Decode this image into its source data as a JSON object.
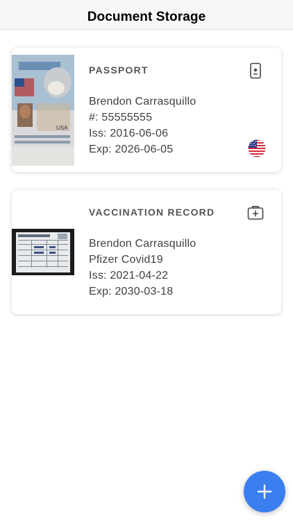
{
  "header": {
    "title": "Document Storage"
  },
  "documents": [
    {
      "type_label": "PASSPORT",
      "lines": [
        "Brendon Carrasquillo",
        "#: 55555555",
        "Iss: 2016-06-06",
        "Exp: 2026-06-05"
      ],
      "type_icon": "id-card-phone-icon",
      "flag_icon": "us-flag-icon"
    },
    {
      "type_label": "VACCINATION RECORD",
      "lines": [
        "Brendon Carrasquillo",
        "Pfizer Covid19",
        "Iss: 2021-04-22",
        "Exp: 2030-03-18"
      ],
      "type_icon": "medical-kit-icon"
    }
  ],
  "fab": {
    "icon": "plus-icon",
    "color": "#3b7ef0"
  }
}
